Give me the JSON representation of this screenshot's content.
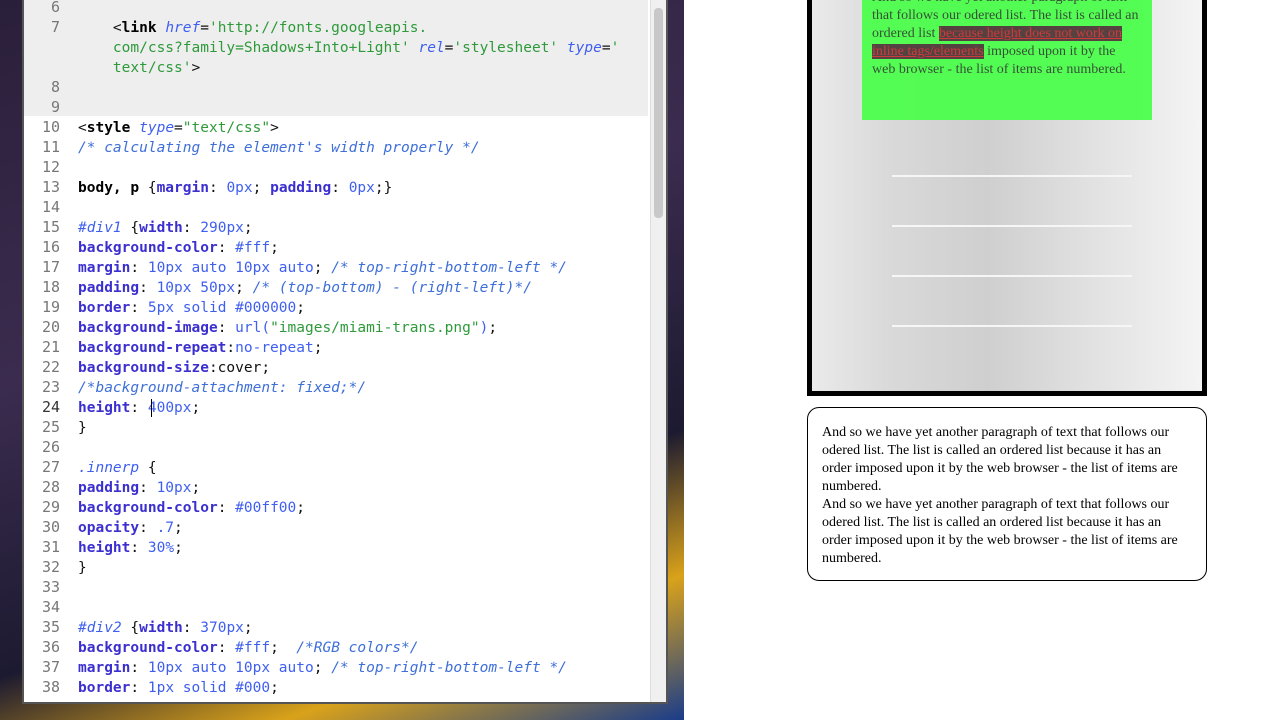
{
  "editor": {
    "first_line": 6,
    "current_line": 24,
    "lines": [
      {
        "n": "6",
        "tokens": []
      },
      {
        "n": "7",
        "tokens": [
          [
            "k",
            "    <"
          ],
          [
            "t",
            "link"
          ],
          [
            "k",
            " "
          ],
          [
            "a",
            "href"
          ],
          [
            "k",
            "="
          ],
          [
            "s",
            "'http://fonts.googleapis."
          ]
        ]
      },
      {
        "n": "",
        "tokens": [
          [
            "s",
            "    com/css?family=Shadows+Into+Light'"
          ],
          [
            "k",
            " "
          ],
          [
            "a",
            "rel"
          ],
          [
            "k",
            "="
          ],
          [
            "s",
            "'stylesheet'"
          ],
          [
            "k",
            " "
          ],
          [
            "a",
            "type"
          ],
          [
            "k",
            "="
          ],
          [
            "s",
            "'"
          ]
        ]
      },
      {
        "n": "",
        "tokens": [
          [
            "s",
            "    text/css'"
          ],
          [
            "k",
            ">"
          ]
        ]
      },
      {
        "n": "8",
        "tokens": []
      },
      {
        "n": "9",
        "tokens": []
      },
      {
        "n": "10",
        "tokens": [
          [
            "k",
            "<"
          ],
          [
            "t",
            "style"
          ],
          [
            "k",
            " "
          ],
          [
            "a",
            "type"
          ],
          [
            "k",
            "="
          ],
          [
            "s",
            "\"text/css\""
          ],
          [
            "k",
            ">"
          ]
        ]
      },
      {
        "n": "11",
        "tokens": [
          [
            "c",
            "/* calculating the element's width properly */"
          ]
        ]
      },
      {
        "n": "12",
        "tokens": []
      },
      {
        "n": "13",
        "tokens": [
          [
            "t",
            "body, p"
          ],
          [
            "k",
            " {"
          ],
          [
            "p",
            "margin"
          ],
          [
            "k",
            ": "
          ],
          [
            "v",
            "0px"
          ],
          [
            "k",
            "; "
          ],
          [
            "p",
            "padding"
          ],
          [
            "k",
            ": "
          ],
          [
            "v",
            "0px"
          ],
          [
            "k",
            ";}"
          ]
        ]
      },
      {
        "n": "14",
        "tokens": []
      },
      {
        "n": "15",
        "tokens": [
          [
            "a",
            "#div1"
          ],
          [
            "k",
            " {"
          ],
          [
            "p",
            "width"
          ],
          [
            "k",
            ": "
          ],
          [
            "v",
            "290px"
          ],
          [
            "k",
            ";"
          ]
        ]
      },
      {
        "n": "16",
        "tokens": [
          [
            "p",
            "background-color"
          ],
          [
            "k",
            ": "
          ],
          [
            "v",
            "#fff"
          ],
          [
            "k",
            ";"
          ]
        ]
      },
      {
        "n": "17",
        "tokens": [
          [
            "p",
            "margin"
          ],
          [
            "k",
            ": "
          ],
          [
            "v",
            "10px auto 10px auto"
          ],
          [
            "k",
            "; "
          ],
          [
            "c",
            "/* top-right-bottom-left */"
          ]
        ]
      },
      {
        "n": "18",
        "tokens": [
          [
            "p",
            "padding"
          ],
          [
            "k",
            ": "
          ],
          [
            "v",
            "10px 50px"
          ],
          [
            "k",
            "; "
          ],
          [
            "c",
            "/* (top-bottom) - (right-left)*/"
          ]
        ]
      },
      {
        "n": "19",
        "tokens": [
          [
            "p",
            "border"
          ],
          [
            "k",
            ": "
          ],
          [
            "v",
            "5px solid #000000"
          ],
          [
            "k",
            ";"
          ]
        ]
      },
      {
        "n": "20",
        "tokens": [
          [
            "p",
            "background-image"
          ],
          [
            "k",
            ": "
          ],
          [
            "v",
            "url("
          ],
          [
            "s",
            "\"images/miami-trans.png\""
          ],
          [
            "v",
            ")"
          ],
          [
            "k",
            ";"
          ]
        ]
      },
      {
        "n": "21",
        "tokens": [
          [
            "p",
            "background-repeat"
          ],
          [
            "k",
            ":"
          ],
          [
            "v",
            "no-repeat"
          ],
          [
            "k",
            ";"
          ]
        ]
      },
      {
        "n": "22",
        "tokens": [
          [
            "p",
            "background-size"
          ],
          [
            "k",
            ":cover;"
          ]
        ]
      },
      {
        "n": "23",
        "tokens": [
          [
            "c",
            "/*background-attachment: fixed;*/"
          ]
        ]
      },
      {
        "n": "24",
        "tokens": [
          [
            "p",
            "height"
          ],
          [
            "k",
            ": "
          ],
          [
            "v",
            "400px"
          ],
          [
            "k",
            ";"
          ]
        ]
      },
      {
        "n": "25",
        "tokens": [
          [
            "k",
            "}"
          ]
        ]
      },
      {
        "n": "26",
        "tokens": []
      },
      {
        "n": "27",
        "tokens": [
          [
            "a",
            ".innerp"
          ],
          [
            "k",
            " {"
          ]
        ]
      },
      {
        "n": "28",
        "tokens": [
          [
            "p",
            "padding"
          ],
          [
            "k",
            ": "
          ],
          [
            "v",
            "10px"
          ],
          [
            "k",
            ";"
          ]
        ]
      },
      {
        "n": "29",
        "tokens": [
          [
            "p",
            "background-color"
          ],
          [
            "k",
            ": "
          ],
          [
            "v",
            "#00ff00"
          ],
          [
            "k",
            ";"
          ]
        ]
      },
      {
        "n": "30",
        "tokens": [
          [
            "p",
            "opacity"
          ],
          [
            "k",
            ": "
          ],
          [
            "v",
            ".7"
          ],
          [
            "k",
            ";"
          ]
        ]
      },
      {
        "n": "31",
        "tokens": [
          [
            "p",
            "height"
          ],
          [
            "k",
            ": "
          ],
          [
            "v",
            "30%"
          ],
          [
            "k",
            ";"
          ]
        ]
      },
      {
        "n": "32",
        "tokens": [
          [
            "k",
            "}"
          ]
        ]
      },
      {
        "n": "33",
        "tokens": []
      },
      {
        "n": "34",
        "tokens": []
      },
      {
        "n": "35",
        "tokens": [
          [
            "a",
            "#div2"
          ],
          [
            "k",
            " {"
          ],
          [
            "p",
            "width"
          ],
          [
            "k",
            ": "
          ],
          [
            "v",
            "370px"
          ],
          [
            "k",
            ";"
          ]
        ]
      },
      {
        "n": "36",
        "tokens": [
          [
            "p",
            "background-color"
          ],
          [
            "k",
            ": "
          ],
          [
            "v",
            "#fff"
          ],
          [
            "k",
            ";  "
          ],
          [
            "c",
            "/*RGB colors*/"
          ]
        ]
      },
      {
        "n": "37",
        "tokens": [
          [
            "p",
            "margin"
          ],
          [
            "k",
            ": "
          ],
          [
            "v",
            "10px auto 10px auto"
          ],
          [
            "k",
            "; "
          ],
          [
            "c",
            "/* top-right-bottom-left */"
          ]
        ]
      },
      {
        "n": "38",
        "tokens": [
          [
            "p",
            "border"
          ],
          [
            "k",
            ": "
          ],
          [
            "v",
            "1px solid #000"
          ],
          [
            "k",
            ";"
          ]
        ]
      }
    ]
  },
  "preview": {
    "innerp": {
      "before": "And so we have yet another paragraph of text that follows our odered list. The list is called an ordered list ",
      "highlight": "because height does not work on inline tags/elements",
      "after": " imposed upon it by the web browser - the list of items are numbered."
    },
    "div2": {
      "para1": "And so we have yet another paragraph of text that follows our odered list. The list is called an ordered list because it has an order imposed upon it by the web browser - the list of items are numbered.",
      "para2": "And so we have yet another paragraph of text that follows our odered list. The list is called an ordered list because it has an order imposed upon it by the web browser - the list of items are numbered."
    }
  }
}
